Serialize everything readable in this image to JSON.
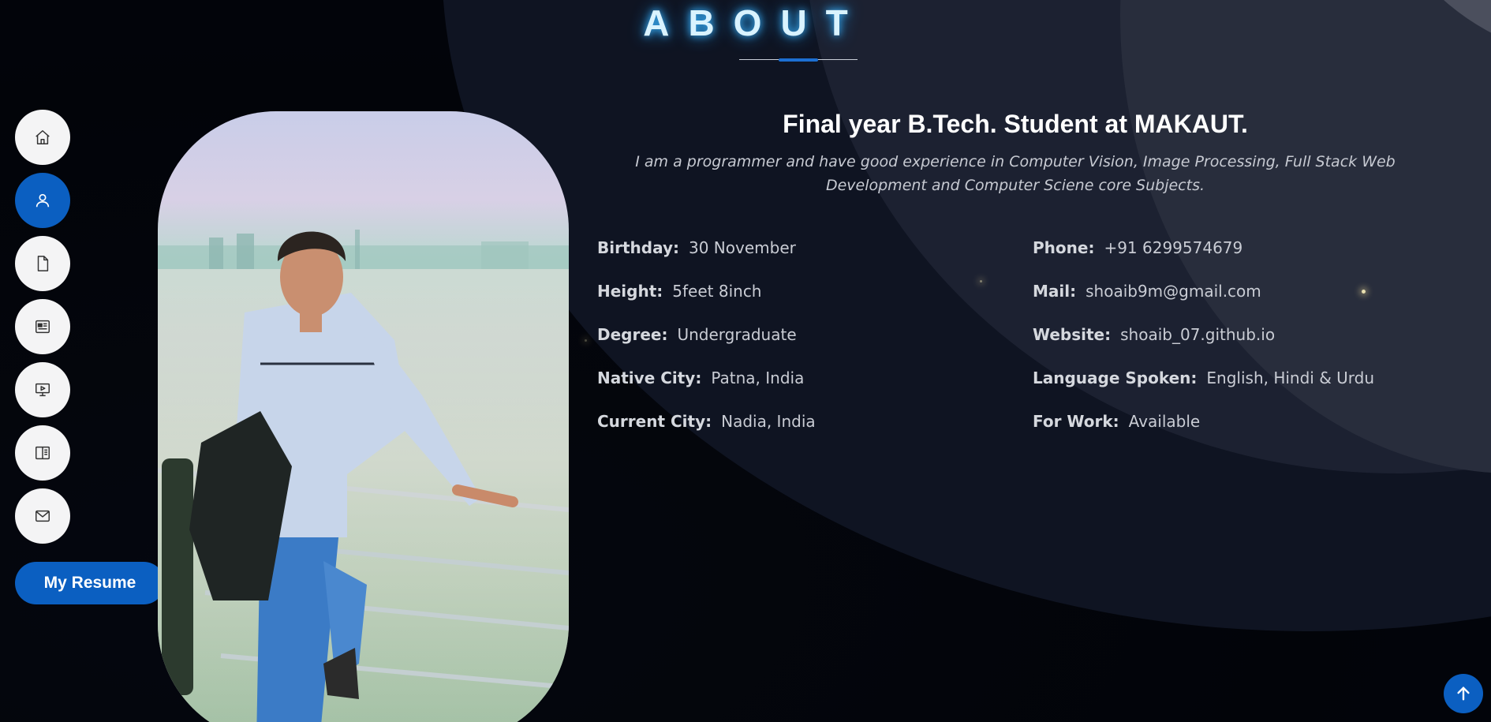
{
  "section": {
    "title": "ABOUT"
  },
  "nav": {
    "items": [
      {
        "name": "home",
        "icon": "home-icon"
      },
      {
        "name": "about",
        "icon": "user-icon",
        "active": true
      },
      {
        "name": "resume",
        "icon": "document-icon"
      },
      {
        "name": "portfolio",
        "icon": "newspaper-icon"
      },
      {
        "name": "services",
        "icon": "presentation-icon"
      },
      {
        "name": "blog",
        "icon": "book-icon"
      },
      {
        "name": "contact",
        "icon": "envelope-icon"
      }
    ],
    "resume_label": "My Resume"
  },
  "about": {
    "headline": "Final year B.Tech. Student at MAKAUT.",
    "intro": "I am a programmer and have good experience in Computer Vision, Image Processing, Full Stack Web Development and Computer Sciene core Subjects.",
    "left": [
      {
        "label": "Birthday:",
        "value": "30 November"
      },
      {
        "label": "Height:",
        "value": "5feet 8inch"
      },
      {
        "label": "Degree:",
        "value": "Undergraduate"
      },
      {
        "label": "Native City:",
        "value": "Patna, India"
      },
      {
        "label": "Current City:",
        "value": "Nadia, India"
      }
    ],
    "right": [
      {
        "label": "Phone:",
        "value": "+91 6299574679"
      },
      {
        "label": "Mail:",
        "value": "shoaib9m@gmail.com"
      },
      {
        "label": "Website:",
        "value": "shoaib_07.github.io"
      },
      {
        "label": "Language Spoken:",
        "value": "English, Hindi & Urdu"
      },
      {
        "label": "For Work:",
        "value": "Available"
      }
    ]
  },
  "colors": {
    "accent": "#0b5fc1",
    "background": "#03050d",
    "title_glow": "#3fb6ff"
  },
  "scroll_top": {
    "icon": "arrow-up-icon"
  }
}
